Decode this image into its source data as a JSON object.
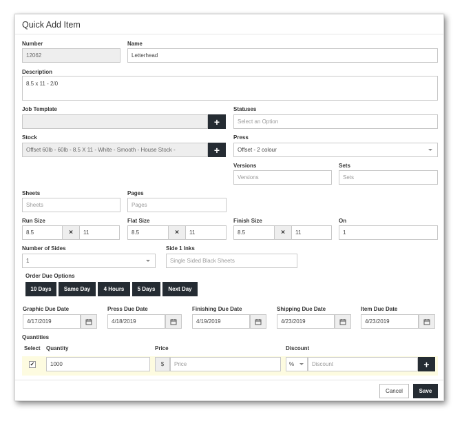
{
  "title": "Quick Add Item",
  "fields": {
    "number": {
      "label": "Number",
      "value": "12062"
    },
    "name": {
      "label": "Name",
      "value": "Letterhead"
    },
    "description": {
      "label": "Description",
      "value": "8.5 x 11 - 2/0"
    },
    "job_template": {
      "label": "Job Template",
      "value": ""
    },
    "statuses": {
      "label": "Statuses",
      "placeholder": "Select an Option"
    },
    "stock": {
      "label": "Stock",
      "value": "Offset 60lb - 60lb - 8.5 X 11 - White - Smooth   - House Stock -"
    },
    "press": {
      "label": "Press",
      "value": "Offset - 2 colour"
    },
    "versions": {
      "label": "Versions",
      "placeholder": "Versions"
    },
    "sets": {
      "label": "Sets",
      "placeholder": "Sets"
    },
    "sheets": {
      "label": "Sheets",
      "placeholder": "Sheets"
    },
    "pages": {
      "label": "Pages",
      "placeholder": "Pages"
    },
    "run_size": {
      "label": "Run Size",
      "width": "8.5",
      "height": "11"
    },
    "flat_size": {
      "label": "Flat Size",
      "width": "8.5",
      "height": "11"
    },
    "finish_size": {
      "label": "Finish Size",
      "width": "8.5",
      "height": "11"
    },
    "on": {
      "label": "On",
      "value": "1"
    },
    "number_of_sides": {
      "label": "Number of Sides",
      "value": "1"
    },
    "side1_inks": {
      "label": "Side 1 Inks",
      "placeholder": "Single Sided Black Sheets"
    }
  },
  "size_separator": "×",
  "plus_glyph": "+",
  "order_due": {
    "label": "Order Due Options",
    "options": [
      "10 Days",
      "Same Day",
      "4 Hours",
      "5 Days",
      "Next Day"
    ]
  },
  "due_dates": [
    {
      "label": "Graphic Due Date",
      "value": "4/17/2019"
    },
    {
      "label": "Press Due Date",
      "value": "4/18/2019"
    },
    {
      "label": "Finishing Due Date",
      "value": "4/19/2019"
    },
    {
      "label": "Shipping Due Date",
      "value": "4/23/2019"
    },
    {
      "label": "Item Due Date",
      "value": "4/23/2019"
    }
  ],
  "quantities": {
    "label": "Quantities",
    "headers": {
      "select": "Select",
      "quantity": "Quantity",
      "price": "Price",
      "discount": "Discount"
    },
    "row": {
      "selected": true,
      "quantity": "1000",
      "currency": "$",
      "price_placeholder": "Price",
      "discount_type": "%",
      "discount_placeholder": "Discount"
    }
  },
  "footer": {
    "cancel": "Cancel",
    "save": "Save"
  },
  "colors": {
    "dark": "#252c33",
    "highlight_row": "#fdfbe0",
    "disabled": "#eeeeee"
  }
}
